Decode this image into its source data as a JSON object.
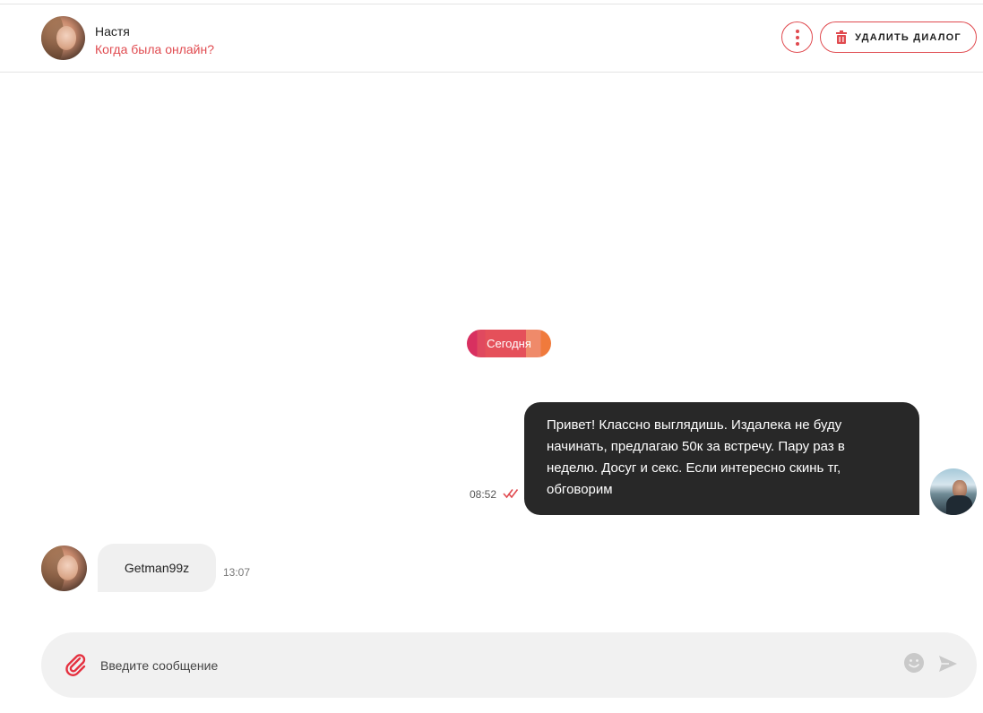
{
  "header": {
    "contact_name": "Настя",
    "status": "Когда была онлайн?",
    "more_icon": "more-vertical-icon",
    "delete_label": "УДАЛИТЬ ДИАЛОГ",
    "delete_icon": "trash-icon"
  },
  "conversation": {
    "date_separator": "Сегодня",
    "messages": [
      {
        "direction": "outgoing",
        "lines": [
          "Привет! Классно выглядишь. Издалека не буду",
          "начинать, предлагаю 50к за встречу. Пару раз в",
          "неделю. Досуг и секс. Если интересно скинь тг,",
          "обговорим"
        ],
        "time": "08:52",
        "status_icon": "double-check-icon"
      },
      {
        "direction": "incoming",
        "text": "Getman99z",
        "time": "13:07"
      }
    ]
  },
  "composer": {
    "placeholder": "Введите сообщение",
    "attach_icon": "paperclip-icon",
    "emoji_icon": "emoji-icon",
    "send_icon": "send-icon"
  },
  "colors": {
    "accent": "#e04a4f",
    "outgoing_bubble": "#282828",
    "incoming_bubble": "#f0f0f0",
    "composer_bg": "#f1f1f1"
  }
}
